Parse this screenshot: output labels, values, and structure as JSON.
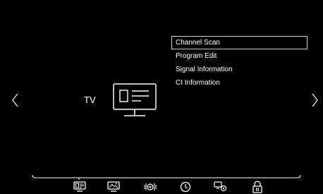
{
  "section": {
    "label": "TV",
    "icon": "tv-icon"
  },
  "menu": {
    "items": [
      {
        "label": "Channel Scan",
        "selected": true
      },
      {
        "label": "Program Edit",
        "selected": false
      },
      {
        "label": "Signal Information",
        "selected": false
      },
      {
        "label": "CI Information",
        "selected": false
      }
    ]
  },
  "navigation": {
    "left_icon": "chevron-left-icon",
    "right_icon": "chevron-right-icon"
  },
  "bottom_bar": {
    "icons": [
      "tv-icon",
      "picture-icon",
      "sound-icon",
      "clock-icon",
      "setup-icon",
      "lock-icon"
    ],
    "active_index": 0
  },
  "colors": {
    "background": "#000000",
    "foreground": "#ffffff",
    "selection_border": "#cfd4d8"
  }
}
